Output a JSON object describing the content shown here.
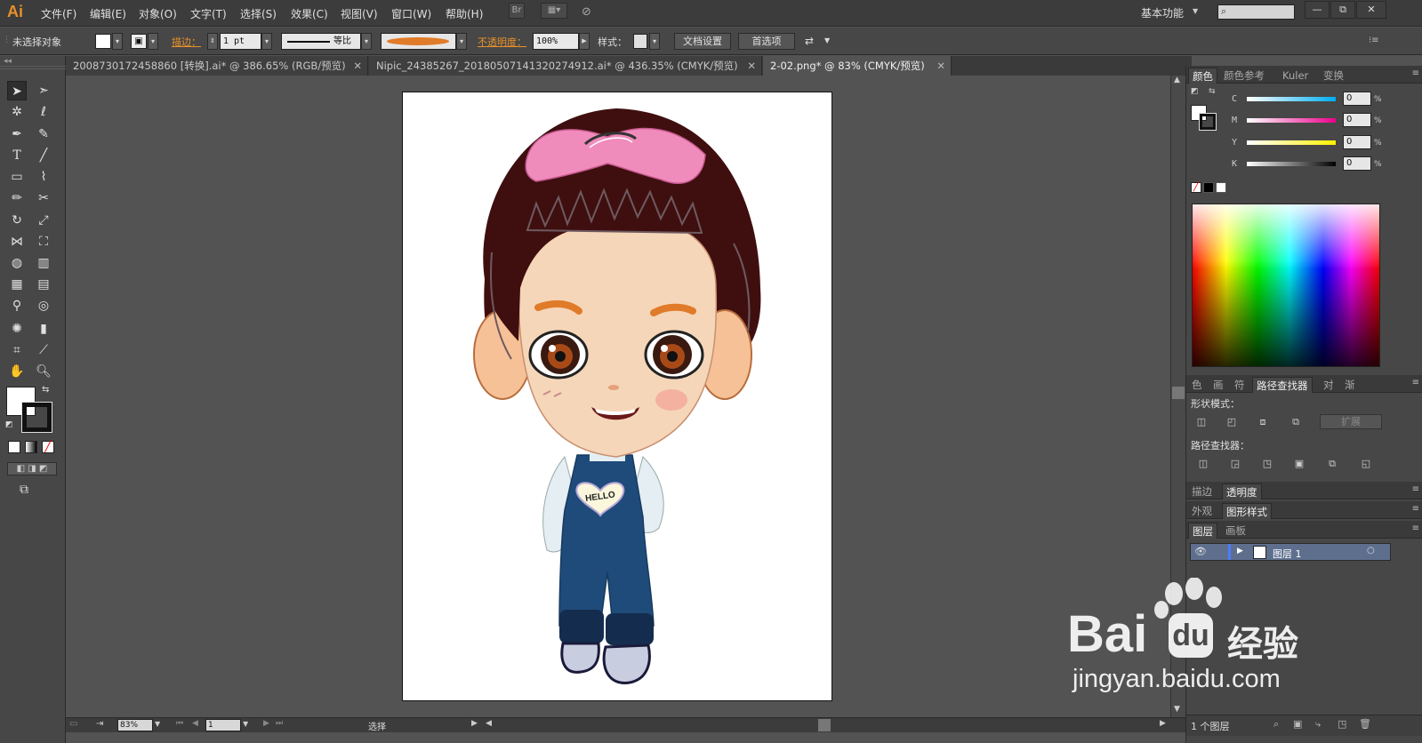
{
  "menubar": {
    "logo": "Ai",
    "items": [
      "文件(F)",
      "编辑(E)",
      "对象(O)",
      "文字(T)",
      "选择(S)",
      "效果(C)",
      "视图(V)",
      "窗口(W)",
      "帮助(H)"
    ],
    "bridge": "Br",
    "workspace": "基本功能",
    "window_buttons": [
      "—",
      "⧉",
      "✕"
    ]
  },
  "controlbar": {
    "selection_status": "未选择对象",
    "stroke_label": "描边：",
    "stroke_weight": "1 pt",
    "stroke_profile": "等比",
    "opacity_label": "不透明度：",
    "opacity_value": "100%",
    "style_label": "样式：",
    "doc_setup_button": "文档设置",
    "preferences_button": "首选项"
  },
  "tabs": [
    {
      "label": "2008730172458860 [转换].ai* @ 386.65% (RGB/预览)",
      "active": false
    },
    {
      "label": "Nipic_24385267_20180507141320274912.ai* @ 436.35% (CMYK/预览)",
      "active": false
    },
    {
      "label": "2-02.png* @ 83% (CMYK/预览)",
      "active": true
    }
  ],
  "color_panel": {
    "tabs": [
      "颜色",
      "颜色参考",
      "Kuler",
      "变换"
    ],
    "channels": [
      {
        "name": "C",
        "value": "0",
        "unit": "%"
      },
      {
        "name": "M",
        "value": "0",
        "unit": "%"
      },
      {
        "name": "Y",
        "value": "0",
        "unit": "%"
      },
      {
        "name": "K",
        "value": "0",
        "unit": "%"
      }
    ]
  },
  "pathfinder_panel": {
    "tabs": [
      "色",
      "画",
      "符",
      "路径查找器",
      "对",
      "渐"
    ],
    "shape_modes_label": "形状模式：",
    "expand_button": "扩展",
    "pathfinders_label": "路径查找器："
  },
  "stroke_panel": {
    "tabs": [
      "描边",
      "透明度"
    ]
  },
  "appearance_panel": {
    "tabs": [
      "外观",
      "图形样式"
    ]
  },
  "layers_panel": {
    "tabs": [
      "图层",
      "画板"
    ],
    "layers": [
      {
        "name": "图层 1"
      }
    ],
    "footer_count": "1 个图层"
  },
  "statusbar": {
    "zoom": "83%",
    "page": "1",
    "tool": "选择"
  },
  "watermark": {
    "brand": "Bai",
    "brand_cn": "经验",
    "url": "jingyan.baidu.com"
  },
  "colors": {
    "accent": "#e8912a",
    "hair": "#3f0f0f",
    "bow": "#f08cbc",
    "skin": "#f5d6b8",
    "overall": "#1f4b7a"
  }
}
